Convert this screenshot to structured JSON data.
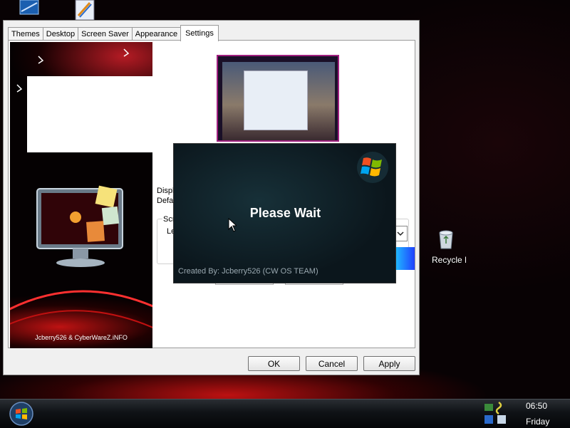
{
  "dialog": {
    "tabs": [
      {
        "label": "Themes"
      },
      {
        "label": "Desktop"
      },
      {
        "label": "Screen Saver"
      },
      {
        "label": "Appearance"
      },
      {
        "label": "Settings"
      }
    ],
    "active_tab": "Settings",
    "side_credit": "Jcberry526 & CyberWareZ.iNFO",
    "fragments": {
      "disp": "Displ",
      "defa": "Defa",
      "scr": "Scr",
      "le": "Le"
    },
    "buttons": {
      "ok": "OK",
      "cancel": "Cancel",
      "apply": "Apply"
    }
  },
  "splash": {
    "message": "Please Wait",
    "credit": "Created By: Jcberry526 (CW OS TEAM)"
  },
  "desktop": {
    "recycle_bin_label": "Recycle Bin"
  },
  "taskbar": {
    "time": "06:50",
    "day": "Friday"
  },
  "colors": {
    "accent_red": "#d01818",
    "dialog_bg": "#f0f0f0",
    "splash_bg": "#0b161c"
  }
}
